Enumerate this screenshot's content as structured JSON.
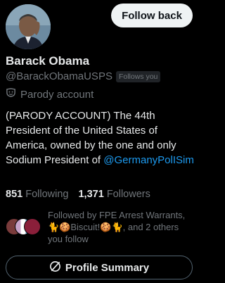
{
  "profile": {
    "display_name": "Barack Obama",
    "handle": "@BarackObamaUSPS",
    "follows_you_badge": "Follows you",
    "parody_label": "Parody account",
    "bio_text": "(PARODY ACCOUNT) The 44th President of the United States of America, owned by the one and only Sodium President of ",
    "bio_mention": "@GermanyPolISim"
  },
  "actions": {
    "follow_back_label": "Follow back",
    "profile_summary_label": "Profile Summary"
  },
  "stats": {
    "following_count": "851",
    "following_label": "Following",
    "followers_count": "1,371",
    "followers_label": "Followers"
  },
  "followed_by": {
    "text": "Followed by FPE Arrest Warrants, 🐈🍪Biscuit!🍪🐈, and 2 others you follow"
  },
  "colors": {
    "background": "#000000",
    "primary_text": "#e7e9ea",
    "secondary_text": "#71767b",
    "link": "#1d9bf0",
    "button_light": "#eff3f4"
  }
}
